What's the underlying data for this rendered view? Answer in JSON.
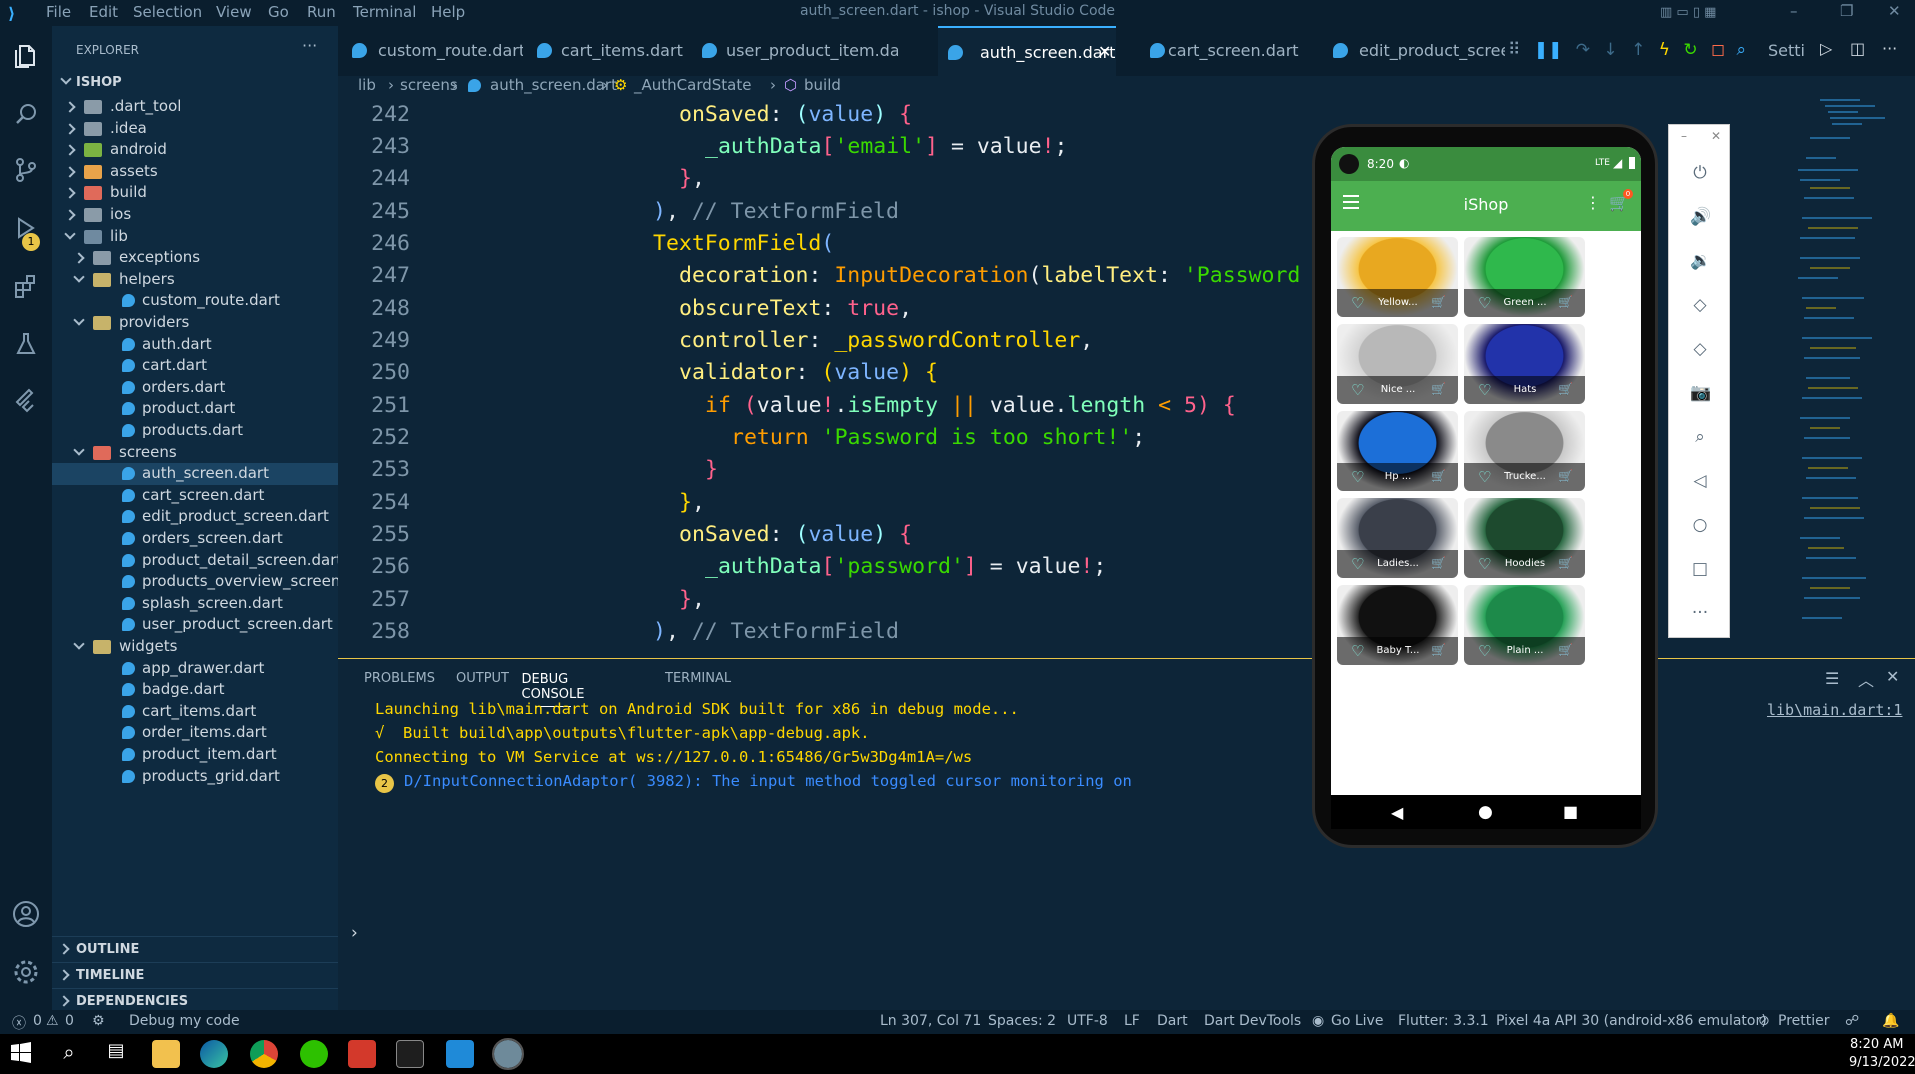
{
  "window": {
    "title": "auth_screen.dart - ishop - Visual Studio Code",
    "menu": [
      "File",
      "Edit",
      "Selection",
      "View",
      "Go",
      "Run",
      "Terminal",
      "Help"
    ]
  },
  "explorer": {
    "header": "EXPLORER",
    "root": "ISHOP",
    "items": [
      ".dart_tool",
      ".idea",
      "android",
      "assets",
      "build",
      "ios",
      "lib",
      "exceptions",
      "helpers",
      "custom_route.dart",
      "providers",
      "auth.dart",
      "cart.dart",
      "orders.dart",
      "product.dart",
      "products.dart",
      "screens",
      "auth_screen.dart",
      "cart_screen.dart",
      "edit_product_screen.dart",
      "orders_screen.dart",
      "product_detail_screen.dart",
      "products_overview_screen....",
      "splash_screen.dart",
      "user_product_screen.dart",
      "widgets",
      "app_drawer.dart",
      "badge.dart",
      "cart_items.dart",
      "order_items.dart",
      "product_item.dart",
      "products_grid.dart"
    ],
    "sections": [
      "OUTLINE",
      "TIMELINE",
      "DEPENDENCIES"
    ]
  },
  "tabs": [
    "custom_route.dart",
    "cart_items.dart",
    "user_product_item.dart",
    "auth_screen.dart",
    "cart_screen.dart",
    "edit_product_screen.",
    "Setti"
  ],
  "breadcrumb": [
    "lib",
    "screens",
    "auth_screen.dart",
    "_AuthCardState",
    "build"
  ],
  "code": {
    "lines": [
      "242",
      "243",
      "244",
      "245",
      "246",
      "247",
      "248",
      "249",
      "250",
      "251",
      "252",
      "253",
      "254",
      "255",
      "256",
      "257",
      "258"
    ],
    "text": [
      "onSaved: (value) {",
      "_authData['email'] = value!;",
      "},",
      "), // TextFormField",
      "TextFormField(",
      "decoration: InputDecoration(labelText: 'Password",
      "obscureText: true,",
      "controller: _passwordController,",
      "validator: (value) {",
      "if (value!.isEmpty || value.length < 5) {",
      "return 'Password is too short!';",
      "}",
      "},",
      "onSaved: (value) {",
      "_authData['password'] = value!;",
      "},",
      "), // TextFormField"
    ]
  },
  "panel": {
    "tabs": [
      "PROBLEMS",
      "OUTPUT",
      "DEBUG CONSOLE",
      "TERMINAL"
    ],
    "lines": [
      "Launching lib\\main.dart on Android SDK built for x86 in debug mode...",
      "√  Built build\\app\\outputs\\flutter-apk\\app-debug.apk.",
      "Connecting to VM Service at ws://127.0.0.1:65486/Gr5w3Dg4m1A=/ws",
      "D/InputConnectionAdaptor( 3982): The input method toggled cursor monitoring on"
    ],
    "badge": "2",
    "link": "lib\\main.dart:1"
  },
  "status": {
    "errors": "0",
    "warnings": "0",
    "debug": "Debug my code",
    "position": "Ln 307, Col 71",
    "spaces": "Spaces: 2",
    "encoding": "UTF-8",
    "eol": "LF",
    "lang": "Dart",
    "devtools": "Dart DevTools",
    "golive": "Go Live",
    "flutter": "Flutter: 3.3.1",
    "device": "Pixel 4a API 30 (android-x86 emulator)",
    "prettier": "Prettier"
  },
  "taskbar": {
    "time": "8:20 AM",
    "date": "9/13/2022"
  },
  "phone": {
    "time": "8:20",
    "net": "LTE",
    "app_title": "iShop",
    "cart_count": "0",
    "products": [
      "Yellow...",
      "Green ...",
      "Nice ...",
      "Hats",
      "Hp ...",
      "Trucke...",
      "Ladies...",
      "Hoodies",
      "Baby T...",
      "Plain ..."
    ]
  },
  "activity": {
    "debug_badge": "1"
  }
}
